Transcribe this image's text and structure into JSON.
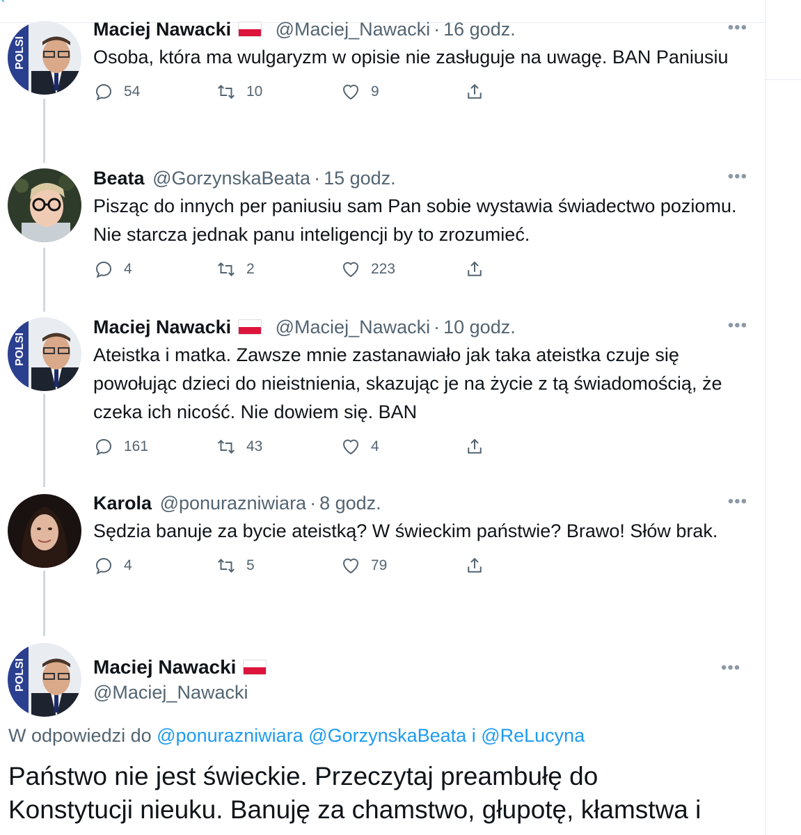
{
  "top_fragment": "‹",
  "tweets": [
    {
      "name": "Maciej Nawacki",
      "has_flag": true,
      "handle": "@Maciej_Nawacki",
      "time": "16 godz.",
      "text": "Osoba, która ma wulgaryzm w opisie nie zasługuje na uwagę. BAN Paniusiu",
      "replies": "54",
      "retweets": "10",
      "likes": "9",
      "avatar": "judge-portrait"
    },
    {
      "name": "Beata",
      "has_flag": false,
      "handle": "@GorzynskaBeata",
      "time": "15 godz.",
      "text": "Pisząc do innych per paniusiu sam Pan sobie wystawia świadectwo poziomu.  Nie starcza jednak panu inteligencji by to zrozumieć.",
      "replies": "4",
      "retweets": "2",
      "likes": "223",
      "avatar": "woman-glasses-portrait"
    },
    {
      "name": "Maciej Nawacki",
      "has_flag": true,
      "handle": "@Maciej_Nawacki",
      "time": "10 godz.",
      "text": "Ateistka i matka. Zawsze mnie zastanawiało jak taka ateistka czuje się powołując dzieci do nieistnienia, skazując je na życie z tą świadomością, że czeka ich nicość. Nie dowiem się. BAN",
      "replies": "161",
      "retweets": "43",
      "likes": "4",
      "avatar": "judge-portrait"
    },
    {
      "name": "Karola",
      "has_flag": false,
      "handle": "@ponurazniwiara",
      "time": "8 godz.",
      "text": "Sędzia banuje za bycie ateistką? W świeckim państwie? Brawo! Słów brak.",
      "replies": "4",
      "retweets": "5",
      "likes": "79",
      "avatar": "woman-dark-hair-portrait"
    }
  ],
  "main_tweet": {
    "name": "Maciej Nawacki",
    "has_flag": true,
    "handle": "@Maciej_Nawacki",
    "reply_prefix": "W odpowiedzi do",
    "mention_1": "@ponurazniwiara",
    "mention_2": "@GorzynskaBeata",
    "reply_and": "i",
    "mention_3": "@ReLucyna",
    "text_line_1": "Państwo nie jest świeckie. Przeczytaj preambułę do",
    "text_line_2": "Konstytucji nieuku. Banuję za chamstwo, głupotę, kłamstwa i"
  },
  "more_glyph": "•••",
  "dot_separator": "·",
  "icons": {
    "reply": "reply-icon",
    "retweet": "retweet-icon",
    "like": "heart-icon",
    "share": "share-icon",
    "more": "more-icon"
  },
  "colors": {
    "accent": "#1d9bf0",
    "secondary_text": "#536471",
    "thread_line": "#cfd9de"
  }
}
